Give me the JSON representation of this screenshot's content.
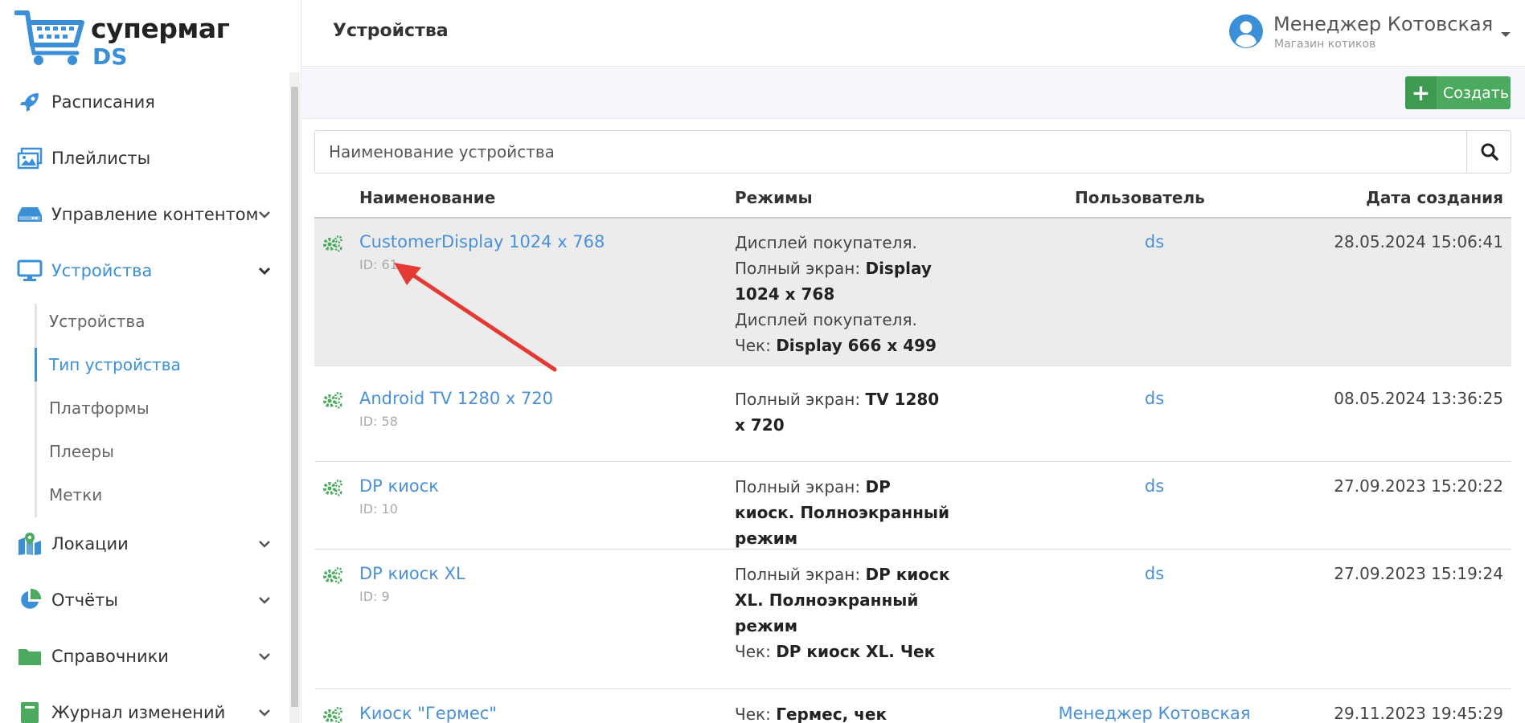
{
  "brand": {
    "top": "супермаг",
    "bottom": "DS"
  },
  "sidebar": {
    "items": [
      {
        "label": "Расписания",
        "icon": "rocket-icon"
      },
      {
        "label": "Плейлисты",
        "icon": "images-icon"
      },
      {
        "label": "Управление контентом",
        "icon": "hdd-icon"
      },
      {
        "label": "Устройства",
        "icon": "monitor-icon"
      },
      {
        "label": "Локации",
        "icon": "map-pin-icon"
      },
      {
        "label": "Отчёты",
        "icon": "pie-chart-icon"
      },
      {
        "label": "Справочники",
        "icon": "folder-icon"
      },
      {
        "label": "Журнал изменений",
        "icon": "book-icon"
      }
    ],
    "subitems": [
      {
        "label": "Устройства"
      },
      {
        "label": "Тип устройства"
      },
      {
        "label": "Платформы"
      },
      {
        "label": "Плееры"
      },
      {
        "label": "Метки"
      }
    ]
  },
  "header": {
    "title": "Устройства",
    "user_name": "Менеджер Котовская",
    "user_shop": "Магазин котиков"
  },
  "toolbar": {
    "create_label": "Создать"
  },
  "search": {
    "placeholder": "Наименование устройства"
  },
  "table": {
    "columns": {
      "name": "Наименование",
      "modes": "Режимы",
      "user": "Пользователь",
      "date": "Дата создания"
    },
    "rows": [
      {
        "name": "CustomerDisplay 1024 x 768",
        "id": "ID: 61",
        "modes": [
          {
            "prefix": "Дисплей покупателя.",
            "label": "",
            "value": ""
          },
          {
            "prefix": "",
            "label": "Полный экран: ",
            "value": "Display 1024 x 768"
          },
          {
            "prefix": "Дисплей покупателя.",
            "label": "",
            "value": ""
          },
          {
            "prefix": "",
            "label": "Чек: ",
            "value": "Display 666 x 499"
          }
        ],
        "user": "ds",
        "date": "28.05.2024 15:06:41"
      },
      {
        "name": "Android TV 1280 x 720",
        "id": "ID: 58",
        "modes": [
          {
            "prefix": "",
            "label": "Полный экран: ",
            "value": "TV 1280 x 720"
          }
        ],
        "user": "ds",
        "date": "08.05.2024 13:36:25"
      },
      {
        "name": "DP киоск",
        "id": "ID: 10",
        "modes": [
          {
            "prefix": "",
            "label": "Полный экран: ",
            "value": "DP киоск. Полноэкранный режим"
          }
        ],
        "user": "ds",
        "date": "27.09.2023 15:20:22"
      },
      {
        "name": "DP киоск XL",
        "id": "ID: 9",
        "modes": [
          {
            "prefix": "",
            "label": "Полный экран: ",
            "value": "DP киоск XL. Полноэкранный режим"
          },
          {
            "prefix": "",
            "label": "Чек: ",
            "value": "DP киоск XL. Чек"
          }
        ],
        "user": "ds",
        "date": "27.09.2023 15:19:24"
      },
      {
        "name": "Киоск \"Гермес\"",
        "id": "",
        "modes": [
          {
            "prefix": "",
            "label": "Чек: ",
            "value": "Гермес, чек"
          }
        ],
        "user": "Менеджер Котовская",
        "date": "29.11.2023 19:45:29"
      }
    ]
  },
  "colors": {
    "accent": "#3a8fd6",
    "link": "#4a90d9",
    "create": "#4caa5e",
    "icon_green": "#4caa5e",
    "arrow": "#e53935"
  }
}
